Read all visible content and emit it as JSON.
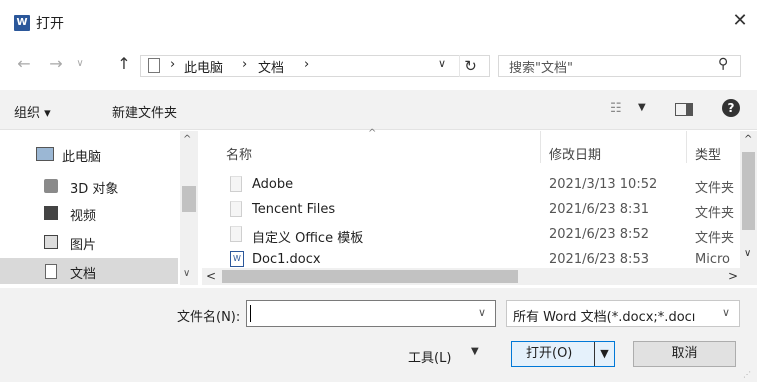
{
  "window": {
    "title": "打开",
    "app_icon": "W"
  },
  "nav": {
    "address": [
      "此电脑",
      "文档"
    ],
    "separator": "›",
    "search_placeholder": "搜索\"文档\""
  },
  "toolbar": {
    "organize": "组织 ▾",
    "new_folder": "新建文件夹"
  },
  "sidebar": {
    "items": [
      {
        "label": "此电脑",
        "icon": "computer-icon"
      },
      {
        "label": "3D 对象",
        "icon": "cube-icon"
      },
      {
        "label": "视频",
        "icon": "video-icon"
      },
      {
        "label": "图片",
        "icon": "picture-icon"
      },
      {
        "label": "文档",
        "icon": "document-icon",
        "selected": true
      }
    ]
  },
  "columns": {
    "name": "名称",
    "modified": "修改日期",
    "type": "类型"
  },
  "files": [
    {
      "name": "Adobe",
      "modified": "2021/3/13 10:52",
      "type": "文件夹"
    },
    {
      "name": "Tencent Files",
      "modified": "2021/6/23 8:31",
      "type": "文件夹"
    },
    {
      "name": "自定义 Office 模板",
      "modified": "2021/6/23 8:52",
      "type": "文件夹"
    },
    {
      "name": "Doc1.docx",
      "modified": "2021/6/23 8:53",
      "type": "Micro"
    }
  ],
  "bottom": {
    "filename_label": "文件名(N):",
    "filename_value": "",
    "filetype": "所有 Word 文档(*.docx;*.docı",
    "tools": "工具(L)",
    "open": "打开(O)",
    "cancel": "取消"
  }
}
